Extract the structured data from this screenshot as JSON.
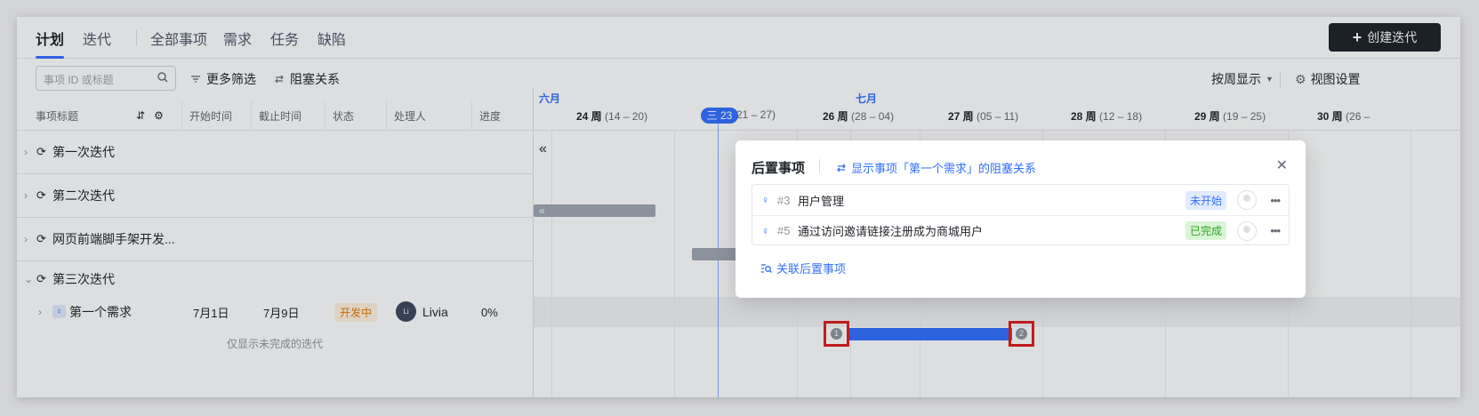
{
  "header": {
    "tabs": [
      {
        "label": "计划",
        "active": true
      },
      {
        "label": "迭代"
      },
      {
        "label": "全部事项"
      },
      {
        "label": "需求"
      },
      {
        "label": "任务"
      },
      {
        "label": "缺陷"
      }
    ],
    "create_button": "创建迭代"
  },
  "filter": {
    "search_placeholder": "事项 ID 或标题",
    "more_filters": "更多筛选",
    "blocking": "阻塞关系",
    "view_mode": "按周显示",
    "view_settings": "视图设置"
  },
  "table": {
    "columns": [
      "事项标题",
      "开始时间",
      "截止时间",
      "状态",
      "处理人",
      "进度"
    ],
    "iterations": [
      {
        "label": "第一次迭代"
      },
      {
        "label": "第二次迭代"
      },
      {
        "label": "网页前端脚手架开发..."
      },
      {
        "label": "第三次迭代"
      }
    ],
    "requirement": {
      "label": "第一个需求",
      "start": "7月1日",
      "end": "7月9日",
      "status": "开发中",
      "assignee_initials": "Li",
      "assignee": "Livia",
      "progress": "0%"
    },
    "footer_note": "仅显示未完成的迭代"
  },
  "gantt": {
    "months": [
      "六月",
      "七月"
    ],
    "today_label": "三 23",
    "weeks": [
      {
        "label": "24 周",
        "range": "(14 – 20)"
      },
      {
        "label": "",
        "range": "(21 – 27)"
      },
      {
        "label": "26 周",
        "range": "(28 – 04)"
      },
      {
        "label": "27 周",
        "range": "(05 – 11)"
      },
      {
        "label": "28 周",
        "range": "(12 – 18)"
      },
      {
        "label": "29 周",
        "range": "(19 – 25)"
      },
      {
        "label": "30 周",
        "range": "(26 –"
      }
    ],
    "collapse_glyph": "«",
    "handle_start": "1",
    "handle_end": "2"
  },
  "popover": {
    "title": "后置事项",
    "link": "显示事项「第一个需求」的阻塞关系",
    "items": [
      {
        "id": "#3",
        "title": "用户管理",
        "status": "未开始"
      },
      {
        "id": "#5",
        "title": "通过访问邀请链接注册成为商城用户",
        "status": "已完成"
      }
    ],
    "action": "关联后置事项"
  }
}
